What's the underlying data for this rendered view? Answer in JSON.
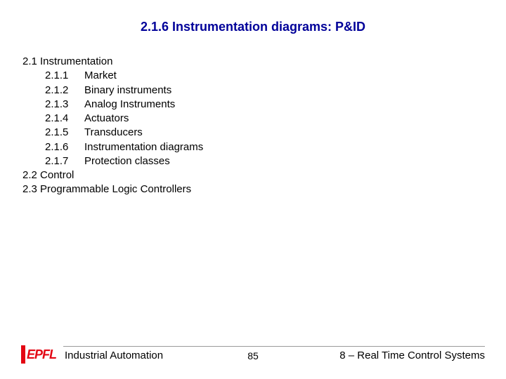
{
  "title": "2.1.6 Instrumentation diagrams: P&ID",
  "outline": {
    "s21": "2.1 Instrumentation",
    "i211_num": "2.1.1",
    "i211_lbl": "Market",
    "i212_num": "2.1.2",
    "i212_lbl": "Binary instruments",
    "i213_num": "2.1.3",
    "i213_lbl": "Analog Instruments",
    "i214_num": "2.1.4",
    "i214_lbl": "Actuators",
    "i215_num": "2.1.5",
    "i215_lbl": "Transducers",
    "i216_num": "2.1.6",
    "i216_lbl": "Instrumentation diagrams",
    "i217_num": "2.1.7",
    "i217_lbl": "Protection classes",
    "s22": "2.2 Control",
    "s23": "2.3 Programmable Logic Controllers"
  },
  "footer": {
    "logo_text": "EPFL",
    "left": "Industrial Automation",
    "page": "85",
    "right": "8 – Real Time Control Systems"
  }
}
